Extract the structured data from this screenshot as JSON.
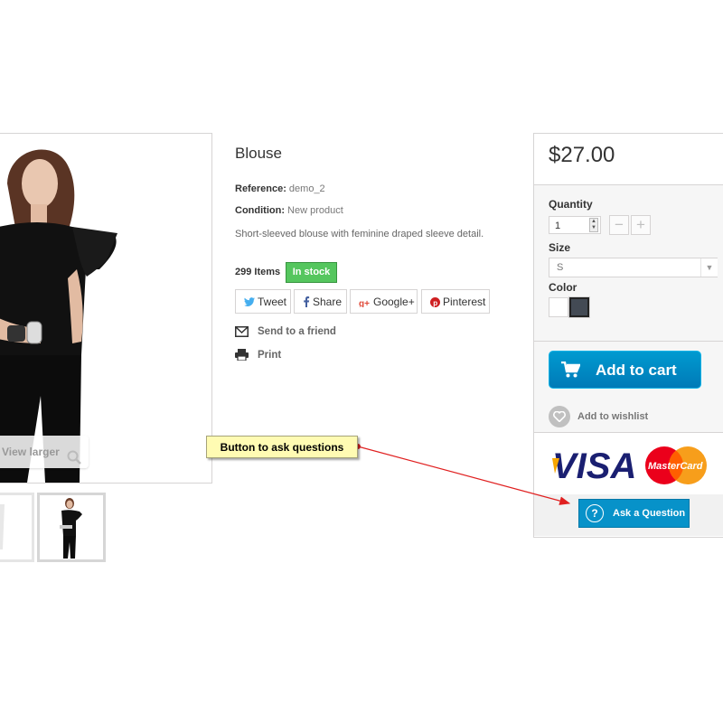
{
  "product": {
    "title": "Blouse",
    "reference_label": "Reference:",
    "reference_value": "demo_2",
    "condition_label": "Condition:",
    "condition_value": "New product",
    "description": "Short-sleeved blouse with feminine draped sleeve detail.",
    "items_count": "299 Items",
    "stock_badge": "In stock",
    "view_larger": "View larger"
  },
  "social": {
    "tweet": "Tweet",
    "share": "Share",
    "google": "Google+",
    "pinterest": "Pinterest"
  },
  "links": {
    "send_friend": "Send to a friend",
    "print": "Print"
  },
  "buybox": {
    "price": "$27.00",
    "quantity_label": "Quantity",
    "quantity_value": "1",
    "size_label": "Size",
    "size_value": "S",
    "color_label": "Color",
    "colors": [
      "#ffffff",
      "#434a54"
    ],
    "add_to_cart": "Add to cart",
    "add_to_wishlist": "Add to wishlist",
    "ask_question": "Ask a Question"
  },
  "payment": {
    "visa": "VISA",
    "mastercard": "MasterCard"
  },
  "annotation": {
    "callout_text": "Button to ask questions"
  },
  "colors": {
    "accent_blue": "#0792c9",
    "in_stock_green": "#55c65e",
    "callout_yellow": "#fffbb3",
    "arrow_red": "#e02020"
  }
}
